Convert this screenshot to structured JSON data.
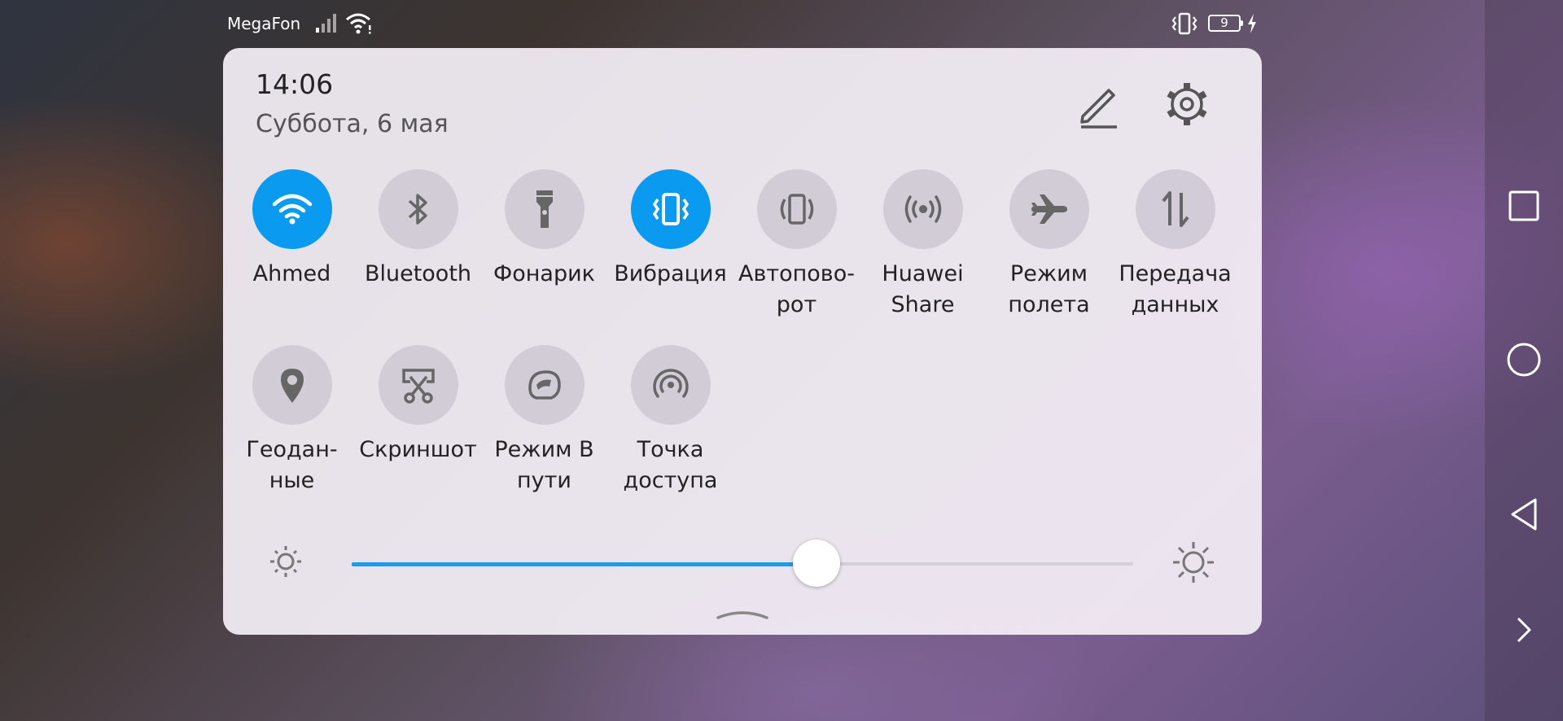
{
  "status_bar": {
    "carrier": "MegaFon",
    "battery_level": "9",
    "icons": [
      "signal-icon",
      "wifi-icon",
      "vibrate-icon",
      "battery-icon",
      "charging-icon"
    ]
  },
  "header": {
    "time": "14:06",
    "date": "Суббота, 6 мая",
    "edit_icon": "pencil-icon",
    "settings_icon": "gear-icon"
  },
  "tiles": [
    {
      "label": "Ahmed",
      "icon": "wifi-icon",
      "active": true
    },
    {
      "label": "Bluetooth",
      "icon": "bluetooth-icon",
      "active": false
    },
    {
      "label": "Фонарик",
      "icon": "flashlight-icon",
      "active": false
    },
    {
      "label": "Вибрация",
      "icon": "vibrate-icon",
      "active": true
    },
    {
      "label": "Автопово-\nрот",
      "icon": "rotate-icon",
      "active": false
    },
    {
      "label": "Huawei\nShare",
      "icon": "share-icon",
      "active": false
    },
    {
      "label": "Режим\nполета",
      "icon": "airplane-icon",
      "active": false
    },
    {
      "label": "Передача\nданных",
      "icon": "data-transfer-icon",
      "active": false
    },
    {
      "label": "Геодан-\nные",
      "icon": "location-icon",
      "active": false
    },
    {
      "label": "Скриншот",
      "icon": "screenshot-icon",
      "active": false
    },
    {
      "label": "Режим В\nпути",
      "icon": "driving-icon",
      "active": false
    },
    {
      "label": "Точка\nдоступа",
      "icon": "hotspot-icon",
      "active": false
    }
  ],
  "brightness": {
    "value": 0.595,
    "low_icon": "brightness-low-icon",
    "high_icon": "brightness-high-icon"
  },
  "colors": {
    "accent": "#0a9af0",
    "tile_inactive": "#cdc8d2",
    "panel": "#f4eff6"
  },
  "nav_bar": [
    "recents-icon",
    "home-icon",
    "back-icon",
    "expand-icon"
  ]
}
